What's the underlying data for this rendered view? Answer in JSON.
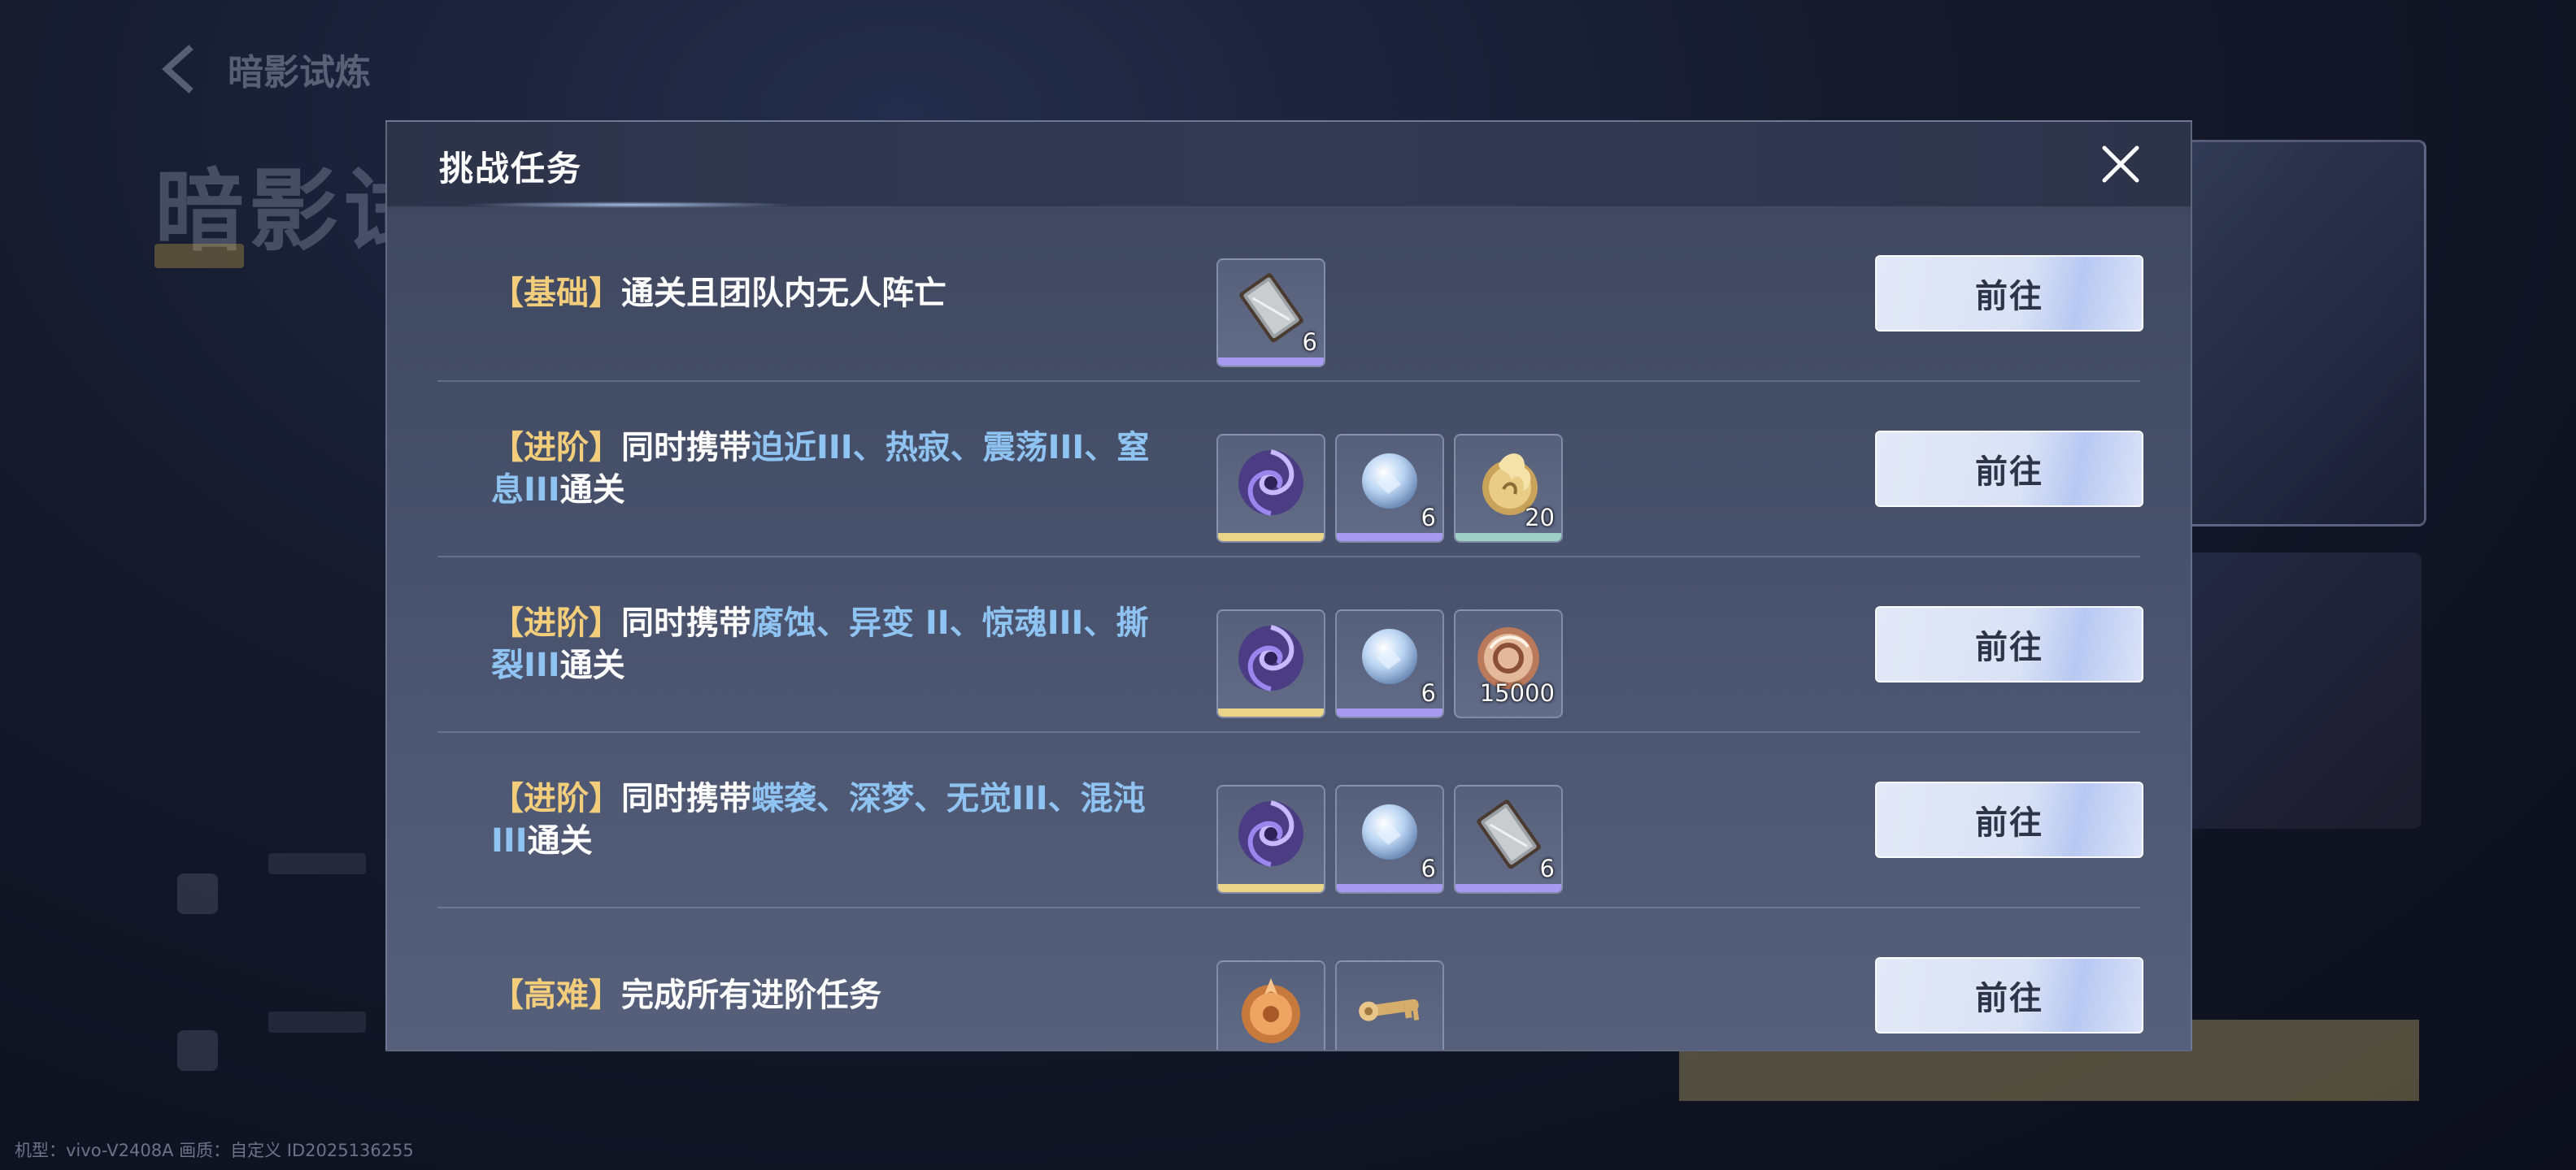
{
  "background": {
    "back_label": "暗影试炼",
    "title": "暗影试"
  },
  "watermark": "机型：vivo-V2408A 画质：自定义 ID2025136255",
  "modal": {
    "title": "挑战任务",
    "close_icon": "close-icon"
  },
  "tasks": [
    {
      "tier": "【基础】",
      "segments": [
        {
          "text": "通关且团队内无人阵亡",
          "hl": false
        }
      ],
      "rewards": [
        {
          "icon": "ingot-icon",
          "qty": "6",
          "rarity": "purple"
        }
      ],
      "button": "前往"
    },
    {
      "tier": "【进阶】",
      "segments": [
        {
          "text": "同时携带",
          "hl": false
        },
        {
          "text": "迫近III",
          "hl": true
        },
        {
          "text": "、",
          "hl": true
        },
        {
          "text": "热寂",
          "hl": true
        },
        {
          "text": "、",
          "hl": true
        },
        {
          "text": "震荡III",
          "hl": true
        },
        {
          "text": "、",
          "hl": true
        },
        {
          "text": "窒息III",
          "hl": true
        },
        {
          "text": "通关",
          "hl": false
        }
      ],
      "rewards": [
        {
          "icon": "vortex-orb-icon",
          "qty": "",
          "rarity": "gold"
        },
        {
          "icon": "crystal-orb-icon",
          "qty": "6",
          "rarity": "purple"
        },
        {
          "icon": "gold-flame-coin-icon",
          "qty": "20",
          "rarity": "teal"
        }
      ],
      "button": "前往"
    },
    {
      "tier": "【进阶】",
      "segments": [
        {
          "text": "同时携带",
          "hl": false
        },
        {
          "text": "腐蚀",
          "hl": true
        },
        {
          "text": "、",
          "hl": true
        },
        {
          "text": "异变 II",
          "hl": true
        },
        {
          "text": "、",
          "hl": true
        },
        {
          "text": "惊魂III",
          "hl": true
        },
        {
          "text": "、",
          "hl": true
        },
        {
          "text": "撕裂III",
          "hl": true
        },
        {
          "text": "通关",
          "hl": false
        }
      ],
      "rewards": [
        {
          "icon": "vortex-orb-icon",
          "qty": "",
          "rarity": "gold"
        },
        {
          "icon": "crystal-orb-icon",
          "qty": "6",
          "rarity": "purple"
        },
        {
          "icon": "copper-coin-icon",
          "qty": "15000",
          "rarity": "none"
        }
      ],
      "button": "前往"
    },
    {
      "tier": "【进阶】",
      "segments": [
        {
          "text": "同时携带",
          "hl": false
        },
        {
          "text": "蝶袭",
          "hl": true
        },
        {
          "text": "、",
          "hl": true
        },
        {
          "text": "深梦",
          "hl": true
        },
        {
          "text": "、",
          "hl": true
        },
        {
          "text": "无觉III",
          "hl": true
        },
        {
          "text": "、",
          "hl": true
        },
        {
          "text": "混沌III",
          "hl": true
        },
        {
          "text": "通关",
          "hl": false
        }
      ],
      "rewards": [
        {
          "icon": "vortex-orb-icon",
          "qty": "",
          "rarity": "gold"
        },
        {
          "icon": "crystal-orb-icon",
          "qty": "6",
          "rarity": "purple"
        },
        {
          "icon": "ingot-icon",
          "qty": "6",
          "rarity": "purple"
        }
      ],
      "button": "前往"
    },
    {
      "tier": "【高难】",
      "segments": [
        {
          "text": "完成所有进阶任务",
          "hl": false
        }
      ],
      "rewards": [
        {
          "icon": "bronze-emblem-icon",
          "qty": "",
          "rarity": "none"
        },
        {
          "icon": "golden-key-icon",
          "qty": "",
          "rarity": "none"
        }
      ],
      "button": "前往"
    }
  ]
}
